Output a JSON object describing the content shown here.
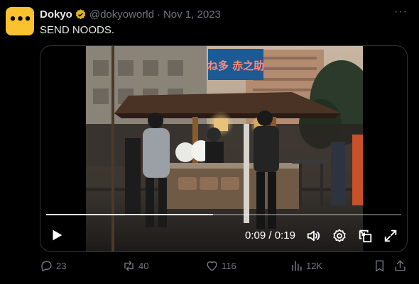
{
  "author": {
    "display_name": "Dokyo",
    "handle": "@dokyoworld",
    "separator": "·",
    "date": "Nov 1, 2023",
    "avatar_glyph": "•••",
    "verified": true,
    "verified_color": "#e2b719"
  },
  "more_label": "···",
  "tweet_text": "SEND NOODS.",
  "stall_sign": "ね多 赤之助",
  "video": {
    "elapsed": "0:09",
    "duration": "0:19",
    "time_separator": " / ",
    "progress": 0.47
  },
  "actions": {
    "replies": "23",
    "reposts": "40",
    "likes": "116",
    "views": "12K"
  },
  "icons": {
    "play": "play-icon",
    "volume": "volume-icon",
    "settings": "gear-icon",
    "pip": "picture-in-picture-icon",
    "fullscreen": "fullscreen-icon",
    "reply": "reply-icon",
    "repost": "repost-icon",
    "like": "heart-icon",
    "views": "views-icon",
    "bookmark": "bookmark-icon",
    "share": "share-icon"
  },
  "colors": {
    "background": "#000000",
    "text": "#e7e9ea",
    "muted": "#71767b",
    "avatar": "#f9c22e",
    "sign": "#1d5a93"
  }
}
